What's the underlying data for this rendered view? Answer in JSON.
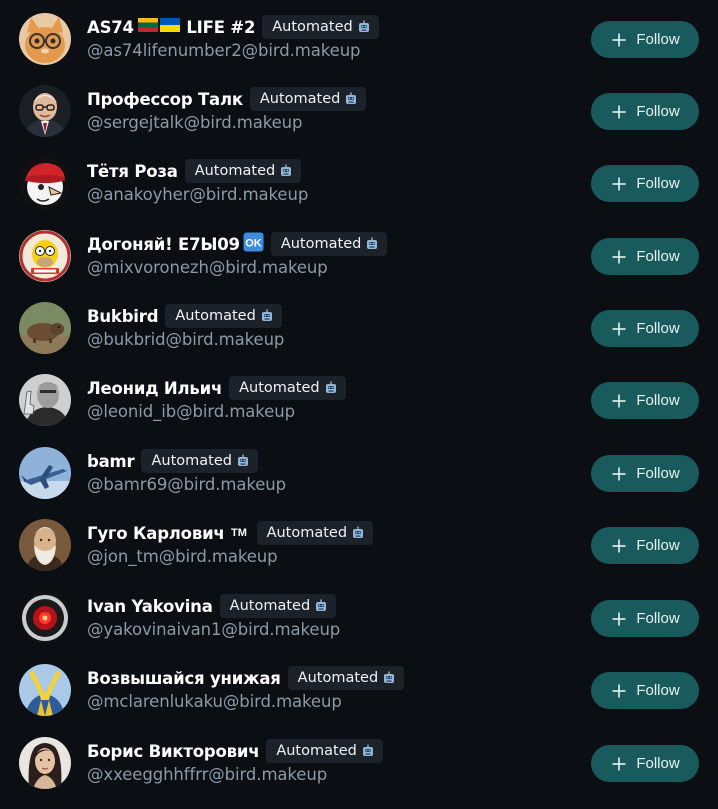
{
  "accounts": [
    {
      "name": "AS74",
      "name_suffix": " LIFE #2",
      "name_flag": "lithuania-ukraine-flags",
      "badge": "Automated",
      "handle": "@as74lifenumber2@bird.makeup",
      "follow_label": "Follow",
      "avatar": "cat-with-glasses"
    },
    {
      "name": "Профессор Талк",
      "name_suffix": "",
      "name_flag": "",
      "badge": "Automated",
      "handle": "@sergejtalk@bird.makeup",
      "follow_label": "Follow",
      "avatar": "old-man-glasses"
    },
    {
      "name": "Тётя Роза",
      "name_suffix": "",
      "name_flag": "",
      "badge": "Automated",
      "handle": "@anakoyher@bird.makeup",
      "follow_label": "Follow",
      "avatar": "red-hat-cartoon"
    },
    {
      "name": "Догоняй! Е7Ы09",
      "name_suffix": "",
      "name_flag": "ok-emoji",
      "badge": "Automated",
      "handle": "@mixvoronezh@bird.makeup",
      "follow_label": "Follow",
      "avatar": "homer-cartoon"
    },
    {
      "name": "Bukbird",
      "name_suffix": "",
      "name_flag": "",
      "badge": "Automated",
      "handle": "@bukbrid@bird.makeup",
      "follow_label": "Follow",
      "avatar": "capybara"
    },
    {
      "name": "Леонид Ильич",
      "name_suffix": "",
      "name_flag": "",
      "badge": "Automated",
      "handle": "@leonid_ib@bird.makeup",
      "follow_label": "Follow",
      "avatar": "man-waving"
    },
    {
      "name": "bamr",
      "name_suffix": "",
      "name_flag": "",
      "badge": "Automated",
      "handle": "@bamr69@bird.makeup",
      "follow_label": "Follow",
      "avatar": "jet-plane"
    },
    {
      "name": "Гуго Карлович",
      "name_suffix": "",
      "name_flag": "tm-emoji",
      "badge": "Automated",
      "handle": "@jon_tm@bird.makeup",
      "follow_label": "Follow",
      "avatar": "bearded-man-portrait"
    },
    {
      "name": "Ivan Yakovina",
      "name_suffix": "",
      "name_flag": "",
      "badge": "Automated",
      "handle": "@yakovinaivan1@bird.makeup",
      "follow_label": "Follow",
      "avatar": "hal9000-eye"
    },
    {
      "name": "Возвышайся унижая",
      "name_suffix": "",
      "name_flag": "",
      "badge": "Automated",
      "handle": "@mclarenlukaku@bird.makeup",
      "follow_label": "Follow",
      "avatar": "yellow-scarf-figure"
    },
    {
      "name": "Борис Викторович",
      "name_suffix": "",
      "name_flag": "",
      "badge": "Automated",
      "handle": "@xxeegghhffrr@bird.makeup",
      "follow_label": "Follow",
      "avatar": "woman-portrait"
    }
  ],
  "colors": {
    "background": "#0b0e12",
    "follow_button": "#195a5c",
    "badge_bg": "#1c222a",
    "handle_text": "#8b9aa5"
  }
}
